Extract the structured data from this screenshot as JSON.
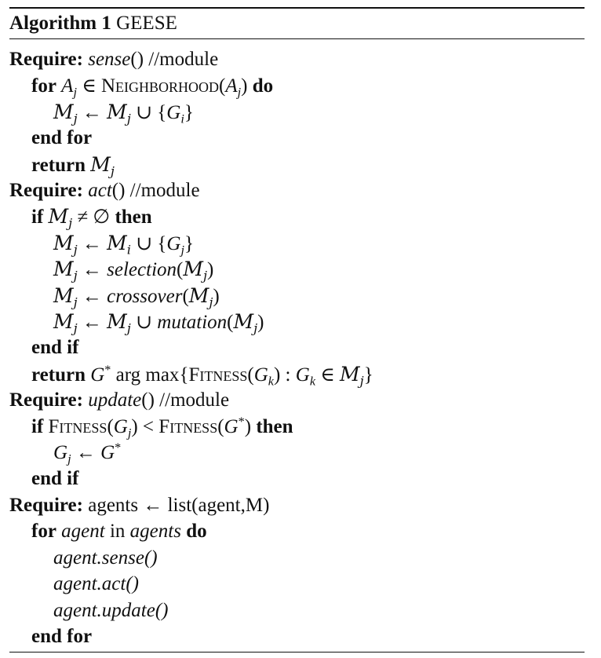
{
  "algorithm": {
    "number_label": "Algorithm 1",
    "name": "GEESE",
    "lines": [
      {
        "indent": 0,
        "text": "Require: sense() //module"
      },
      {
        "indent": 1,
        "text": "for A_j ∈ NEIGHBORHOOD(A_j) do"
      },
      {
        "indent": 2,
        "text": "M_j ← M_j ∪ {G_i}"
      },
      {
        "indent": 1,
        "text": "end for"
      },
      {
        "indent": 1,
        "text": "return M_j"
      },
      {
        "indent": 0,
        "text": "Require: act() //module"
      },
      {
        "indent": 1,
        "text": "if M_j ≠ ∅ then"
      },
      {
        "indent": 2,
        "text": "M_j ← M_i ∪ {G_j}"
      },
      {
        "indent": 2,
        "text": "M_j ← selection(M_j)"
      },
      {
        "indent": 2,
        "text": "M_j ← crossover(M_j)"
      },
      {
        "indent": 2,
        "text": "M_j ← M_j ∪ mutation(M_j)"
      },
      {
        "indent": 1,
        "text": "end if"
      },
      {
        "indent": 1,
        "text": "return G* arg max{FITNESS(G_k) : G_k ∈ M_j}"
      },
      {
        "indent": 0,
        "text": "Require: update() //module"
      },
      {
        "indent": 1,
        "text": "if FITNESS(G_j) < FITNESS(G*) then"
      },
      {
        "indent": 2,
        "text": "G_j ← G*"
      },
      {
        "indent": 1,
        "text": "end if"
      },
      {
        "indent": 0,
        "text": "Require: agents ← list(agent,M)"
      },
      {
        "indent": 1,
        "text": "for agent in agents do"
      },
      {
        "indent": 2,
        "text": "agent.sense()"
      },
      {
        "indent": 2,
        "text": "agent.act()"
      },
      {
        "indent": 2,
        "text": "agent.update()"
      },
      {
        "indent": 1,
        "text": "end for"
      }
    ]
  },
  "tokens": {
    "require": "Require:",
    "for": "for",
    "do": "do",
    "end_for": "end for",
    "return": "return",
    "if": "if",
    "then": "then",
    "end_if": "end if",
    "in": "in",
    "neighborhood": "Neighborhood",
    "fitness": "Fitness",
    "sense": "sense",
    "act": "act",
    "update": "update",
    "module": "() //module",
    "selection": "selection",
    "crossover": "crossover",
    "mutation": "mutation",
    "agents_list": "agents ← list(agent,M)",
    "agent": "agent",
    "agents": "agents",
    "agent_sense": "agent.sense()",
    "agent_act": "agent.act()",
    "agent_update": "agent.update()",
    "argmax": "arg max"
  }
}
